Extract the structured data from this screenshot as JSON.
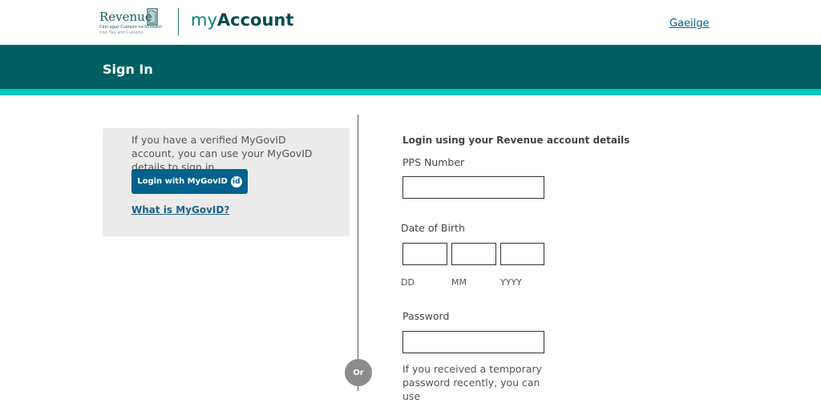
{
  "header": {
    "logo_name": "Revenue",
    "logo_sub_irish": "Cáin agus Custaim na hÉireann",
    "logo_sub_english": "Irish Tax and Customs",
    "brand_my": "my",
    "brand_account": "Account",
    "language_link": "Gaeilge"
  },
  "banner": {
    "title": "Sign In"
  },
  "mygovid": {
    "description": "If you have a verified MyGovID account, you can use your MyGovID details to sign in",
    "button_label": "Login with MyGovID",
    "button_badge": "id",
    "what_link": "What is MyGovID?"
  },
  "divider": {
    "or_label": "Or"
  },
  "form": {
    "heading": "Login using your Revenue account details",
    "pps_label": "PPS Number",
    "pps_value": "",
    "dob_label": "Date of Birth",
    "dob_day_label": "DD",
    "dob_month_label": "MM",
    "dob_year_label": "YYYY",
    "password_label": "Password",
    "password_value": "",
    "temp_password_help": "If you received a temporary password recently, you can use"
  },
  "colors": {
    "banner": "#005f63",
    "stripe": "#00c4bf",
    "button": "#00628c",
    "link": "#00628c"
  }
}
